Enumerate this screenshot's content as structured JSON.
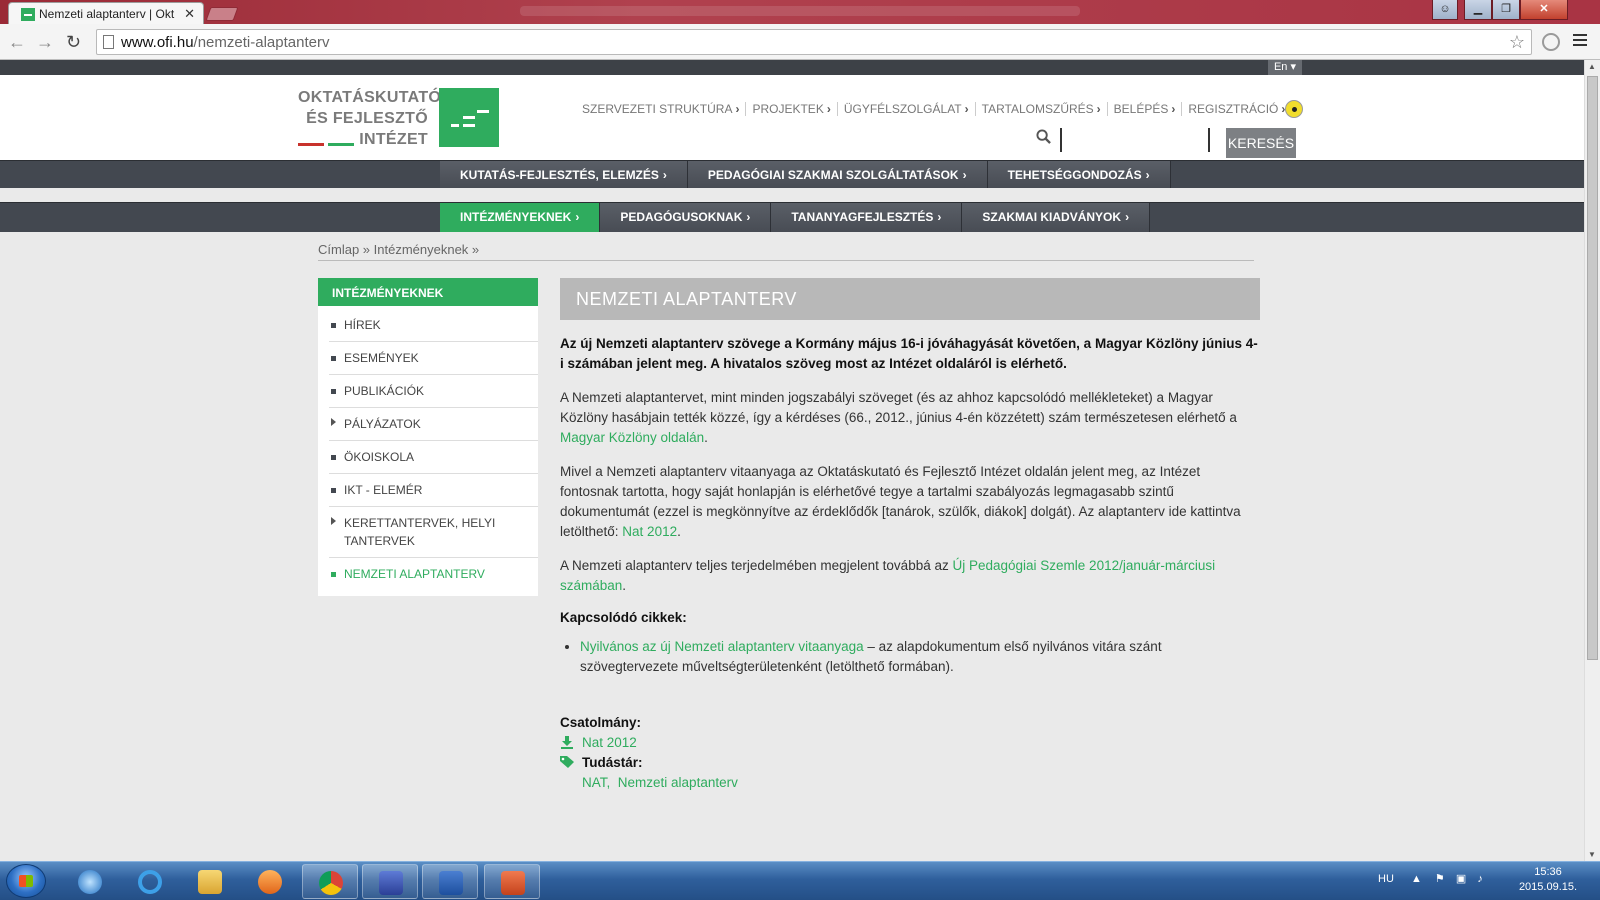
{
  "browser": {
    "tab_title": "Nemzeti alaptanterv | Okt",
    "tab_close": "✕",
    "url_host": "www.ofi.hu",
    "url_path": "/nemzeti-alaptanterv",
    "window_buttons": {
      "minimize": "▁",
      "maximize": "❐",
      "close": "✕"
    },
    "back": "←",
    "forward": "→",
    "reload": "↻",
    "star": "☆"
  },
  "site": {
    "lang": "En ▾",
    "logo_lines": [
      "OKTATÁSKUTATÓ",
      "ÉS FEJLESZTŐ",
      "INTÉZET"
    ],
    "brand_color": "#2fac5e",
    "top_links": [
      {
        "label": "SZERVEZETI STRUKTÚRA",
        "chev": "›"
      },
      {
        "label": "PROJEKTEK",
        "chev": "›"
      },
      {
        "label": "ÜGYFÉLSZOLGÁLAT",
        "chev": "›"
      },
      {
        "label": "TARTALOMSZŰRÉS",
        "chev": "›"
      },
      {
        "label": "BELÉPÉS",
        "chev": "›"
      },
      {
        "label": "REGISZTRÁCIÓ",
        "chev": "›"
      }
    ],
    "search_button": "KERESÉS",
    "search_value": "",
    "main_nav_1": [
      {
        "label": "KUTATÁS-FEJLESZTÉS, ELEMZÉS",
        "chev": "›"
      },
      {
        "label": "PEDAGÓGIAI SZAKMAI SZOLGÁLTATÁSOK",
        "chev": "›"
      },
      {
        "label": "TEHETSÉGGONDOZÁS",
        "chev": "›"
      }
    ],
    "main_nav_2": [
      {
        "label": "INTÉZMÉNYEKNEK",
        "chev": "›",
        "active": true
      },
      {
        "label": "PEDAGÓGUSOKNAK",
        "chev": "›"
      },
      {
        "label": "TANANYAGFEJLESZTÉS",
        "chev": "›"
      },
      {
        "label": "SZAKMAI KIADVÁNYOK",
        "chev": "›"
      }
    ]
  },
  "breadcrumb": "Címlap » Intézményeknek »",
  "sidebar": {
    "header": "INTÉZMÉNYEKNEK",
    "items": [
      {
        "label": "HÍREK",
        "marker": "bullet"
      },
      {
        "label": "ESEMÉNYEK",
        "marker": "bullet"
      },
      {
        "label": "PUBLIKÁCIÓK",
        "marker": "bullet"
      },
      {
        "label": "PÁLYÁZATOK",
        "marker": "triangle"
      },
      {
        "label": "ÖKOISKOLA",
        "marker": "bullet"
      },
      {
        "label": "IKT - ELEMÉR",
        "marker": "bullet"
      },
      {
        "label": "KERETTANTERVEK, HELYI TANTERVEK",
        "marker": "triangle"
      },
      {
        "label": "NEMZETI ALAPTANTERV",
        "marker": "bullet",
        "active": true
      }
    ]
  },
  "article": {
    "title": "NEMZETI ALAPTANTERV",
    "lead": "Az új Nemzeti alaptanterv szövege a Kormány május 16-i jóváhagyását követően, a Magyar Közlöny június 4-i számában jelent meg. A hivatalos szöveg most az Intézet oldaláról is elérhető.",
    "p1_text": "A Nemzeti alaptantervet, mint minden jogszabályi szöveget (és az ahhoz kapcsolódó mellékleteket) a Magyar Közlöny hasábjain tették közzé, így a kérdéses (66., 2012., június 4-én közzétett) szám természetesen elérhető a ",
    "p1_link": "Magyar Közlöny oldalán",
    "p1_end": ".",
    "p2_text": "Mivel a Nemzeti alaptanterv vitaanyaga az Oktatáskutató és Fejlesztő Intézet oldalán jelent meg, az Intézet fontosnak tartotta, hogy saját honlapján is elérhetővé tegye a tartalmi szabályozás legmagasabb szintű dokumentumát (ezzel is megkönnyítve az érdeklődők [tanárok, szülők, diákok] dolgát). Az alaptanterv ide kattintva letölthető: ",
    "p2_link": "Nat 2012",
    "p2_end": ".",
    "p3_text": "A Nemzeti alaptanterv teljes terjedelmében megjelent továbbá az ",
    "p3_link": "Új Pedagógiai Szemle 2012/január-márciusi számában",
    "p3_end": ".",
    "related_heading": "Kapcsolódó cikkek:",
    "related_link": "Nyilvános az új Nemzeti alaptanterv vitaanyaga",
    "related_text": " – az alapdokumentum első nyilvános vitára szánt szövegtervezete műveltségterületenként (letölthető formában).",
    "attachment_heading": "Csatolmány:",
    "attachment_link": "Nat 2012",
    "tudastar_heading": "Tudástár:",
    "tags": [
      "NAT,",
      "Nemzeti alaptanterv"
    ]
  },
  "taskbar": {
    "lang": "HU",
    "time": "15:36",
    "date": "2015.09.15."
  }
}
